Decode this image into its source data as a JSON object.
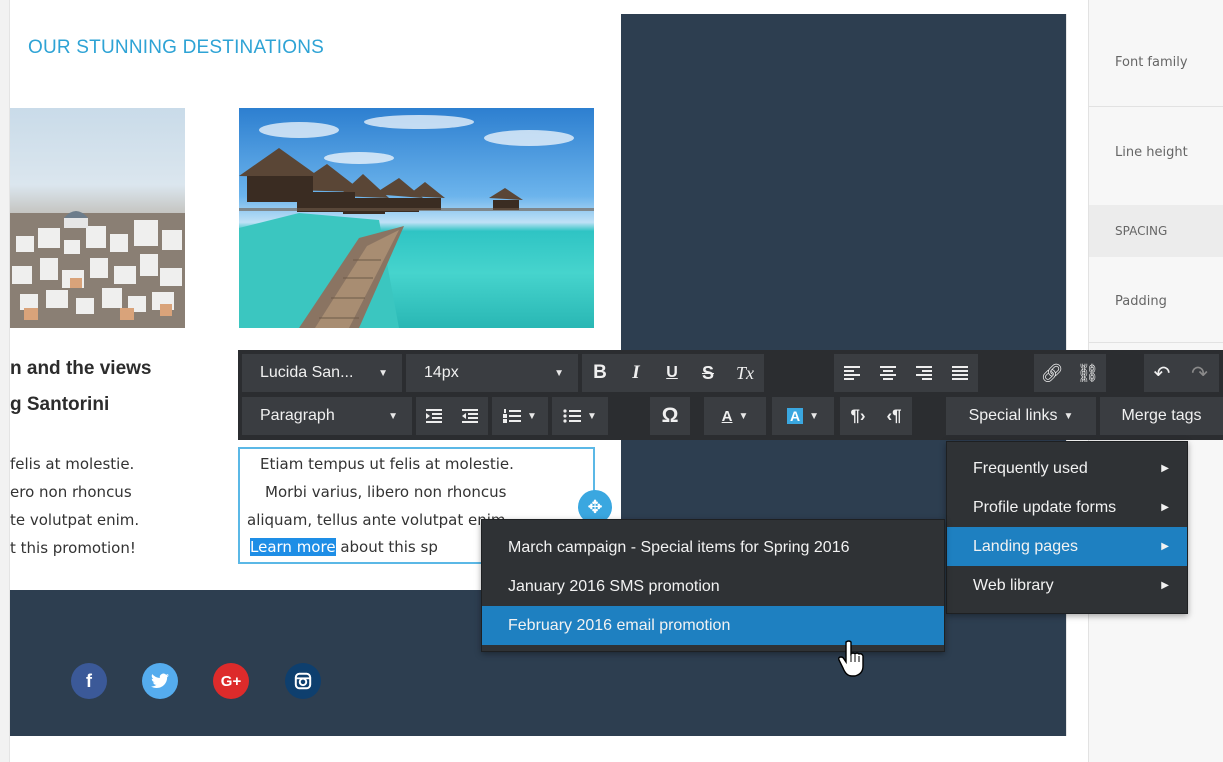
{
  "canvas": {
    "section_title": "OUR STUNNING DESTINATIONS",
    "card_left": {
      "heading_1": "n and the views",
      "heading_2": "g Santorini",
      "lines": [
        "felis at molestie.",
        "ero non rhoncus",
        "te volutpat enim.",
        "t this promotion!"
      ]
    },
    "card_right": {
      "line_1": "Etiam tempus ut felis at molestie.",
      "line_2": "Morbi varius, libero non rhoncus",
      "line_3": "aliquam, tellus ante volutpat enim.",
      "link_text": "Learn more",
      "line_4_rest": " about this sp"
    }
  },
  "toolbar": {
    "font_family": "Lucida San...",
    "font_size": "14px",
    "bold": "B",
    "italic": "I",
    "underline": "U",
    "strike": "S",
    "clear_format": "Tx",
    "block_format": "Paragraph",
    "special_char": "Ω",
    "text_color": "A",
    "bg_color": "A",
    "special_links": "Special links",
    "merge_tags": "Merge tags"
  },
  "special_links_menu": {
    "items": [
      "Frequently used",
      "Profile update forms",
      "Landing pages",
      "Web library"
    ]
  },
  "landing_pages_menu": {
    "items": [
      "March campaign - Special items for Spring 2016",
      "January 2016 SMS promotion",
      "February 2016 email promotion"
    ]
  },
  "right_panel": {
    "font_family": "Font family",
    "line_height": "Line height",
    "spacing": "SPACING",
    "padding": "Padding"
  },
  "colors": {
    "accent": "#2ea3d5",
    "toolbar_bg": "#2b2d30",
    "menu_active": "#1e80c1",
    "dark_section": "#2d3e50",
    "facebook": "#3b5998",
    "twitter": "#55acee",
    "google_plus": "#dd2b2b",
    "instagram": "#0e3f6e"
  }
}
